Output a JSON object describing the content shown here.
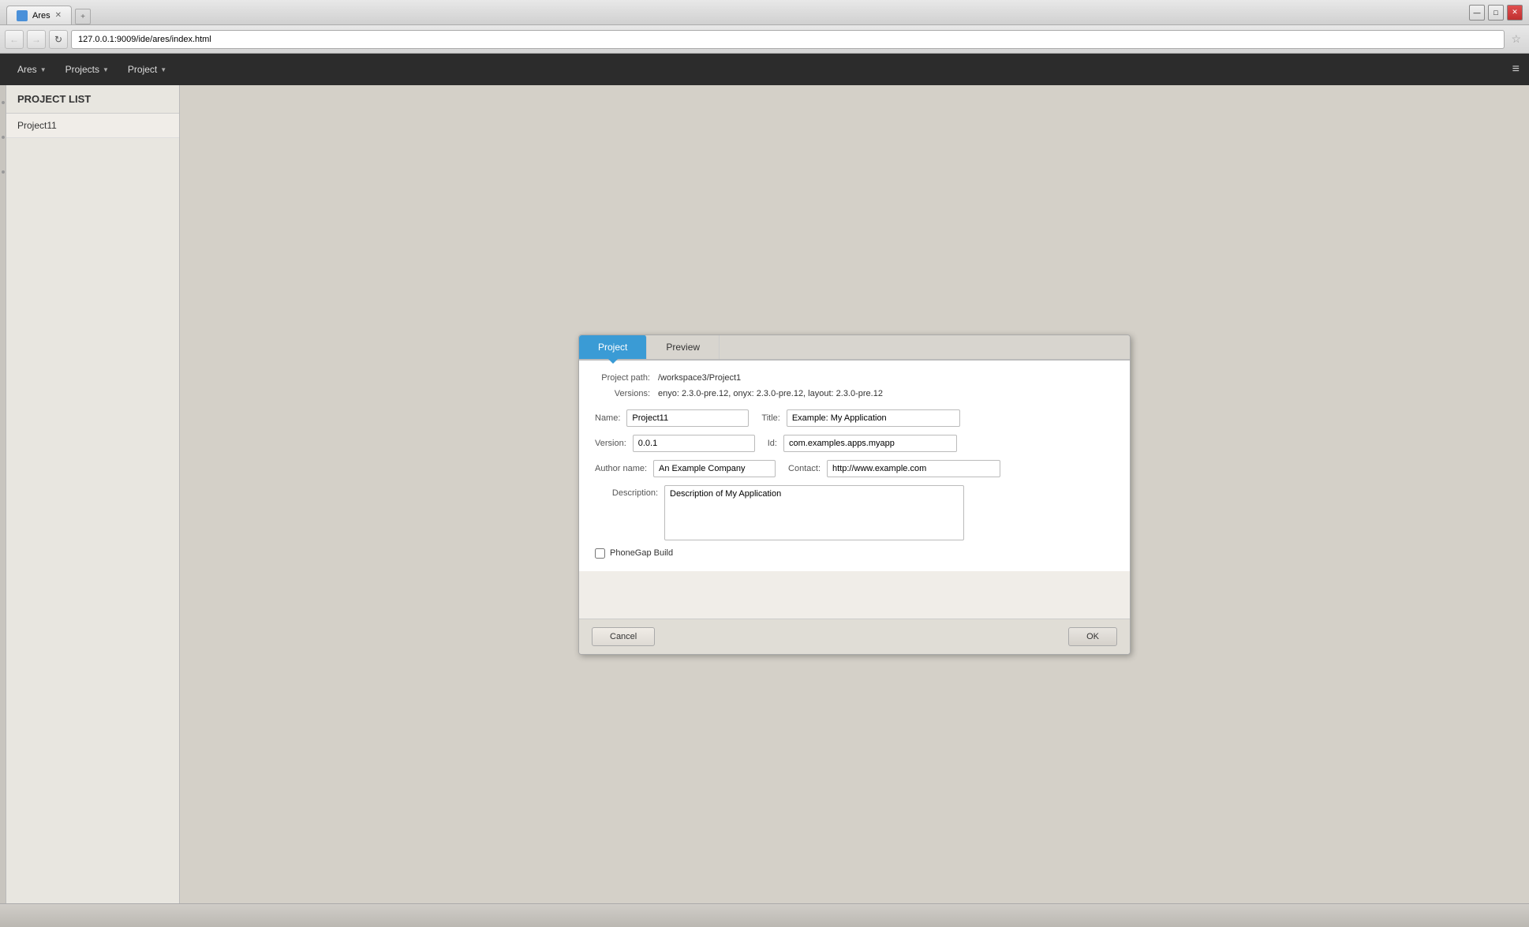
{
  "browser": {
    "tab_title": "Ares",
    "tab_favicon": "A",
    "url": "127.0.0.1:9009/ide/ares/index.html",
    "window_buttons": {
      "minimize": "—",
      "maximize": "□",
      "close": "✕"
    }
  },
  "nav": {
    "back": "←",
    "forward": "→",
    "refresh": "↻"
  },
  "toolbar": {
    "menu_items": [
      {
        "label": "Ares",
        "has_arrow": true
      },
      {
        "label": "Projects",
        "has_arrow": true
      },
      {
        "label": "Project",
        "has_arrow": true
      }
    ],
    "settings_icon": "≡"
  },
  "sidebar": {
    "header": "PROJECT LIST",
    "items": [
      {
        "label": "Project11"
      }
    ]
  },
  "dialog": {
    "tabs": [
      {
        "label": "Project",
        "active": true
      },
      {
        "label": "Preview",
        "active": false
      }
    ],
    "project_path_label": "Project path:",
    "project_path_value": "/workspace3/Project1",
    "versions_label": "Versions:",
    "versions_value": "enyo: 2.3.0-pre.12, onyx: 2.3.0-pre.12, layout: 2.3.0-pre.12",
    "fields": {
      "name_label": "Name:",
      "name_value": "Project11",
      "title_label": "Title:",
      "title_value": "Example: My Application",
      "version_label": "Version:",
      "version_value": "0.0.1",
      "id_label": "Id:",
      "id_value": "com.examples.apps.myapp",
      "author_name_label": "Author name:",
      "author_name_value": "An Example Company",
      "contact_label": "Contact:",
      "contact_value": "http://www.example.com",
      "description_label": "Description:",
      "description_value": "Description of My Application",
      "phonegap_label": "PhoneGap Build",
      "phonegap_checked": false
    },
    "buttons": {
      "cancel": "Cancel",
      "ok": "OK"
    }
  },
  "statusbar": {
    "text": ""
  }
}
